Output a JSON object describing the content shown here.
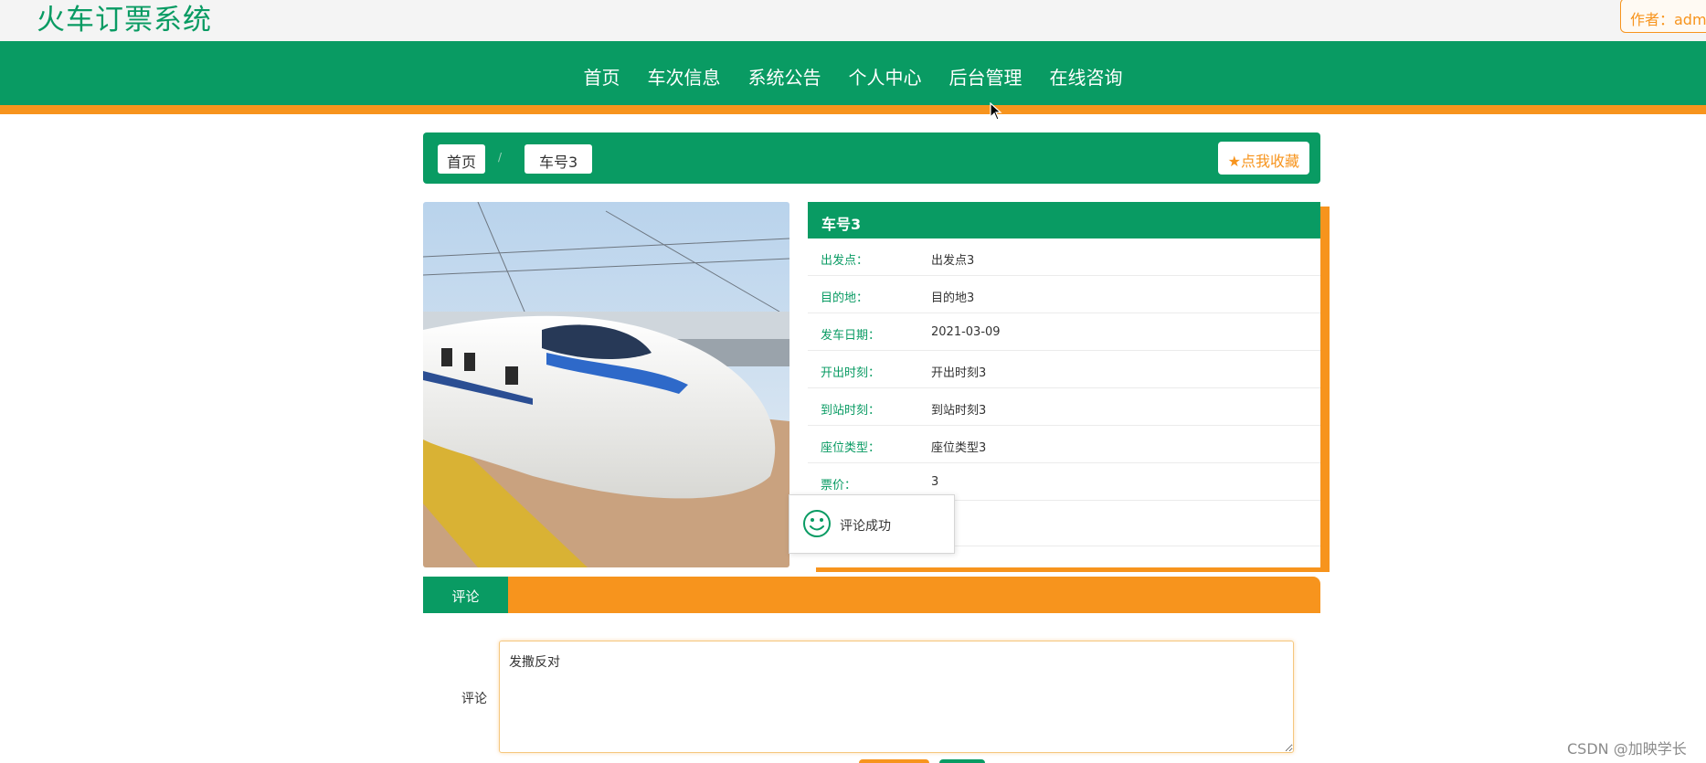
{
  "site": {
    "title": "火车订票系统",
    "author": "作者：admi"
  },
  "nav": {
    "items": [
      "首页",
      "车次信息",
      "系统公告",
      "个人中心",
      "后台管理",
      "在线咨询"
    ]
  },
  "breadcrumb": {
    "home": "首页",
    "separator": "/",
    "current": "车号3"
  },
  "favorite_button": "★点我收藏",
  "detail": {
    "title": "车号3",
    "rows": [
      {
        "label": "出发点：",
        "value": "出发点3"
      },
      {
        "label": "目的地：",
        "value": "目的地3"
      },
      {
        "label": "发车日期：",
        "value": "2021-03-09"
      },
      {
        "label": "开出时刻：",
        "value": "开出时刻3"
      },
      {
        "label": "到站时刻：",
        "value": "到站时刻3"
      },
      {
        "label": "座位类型：",
        "value": "座位类型3"
      },
      {
        "label": "票价：",
        "value": "3"
      },
      {
        "label": "",
        "value": ""
      }
    ]
  },
  "toast": {
    "text": "评论成功",
    "icon": "smile-icon"
  },
  "tabs": {
    "active": "评论"
  },
  "comment": {
    "label": "评论",
    "value": "发撒反对"
  },
  "watermark": "CSDN @加映学长",
  "colors": {
    "primary": "#099b63",
    "accent": "#f7941d"
  }
}
